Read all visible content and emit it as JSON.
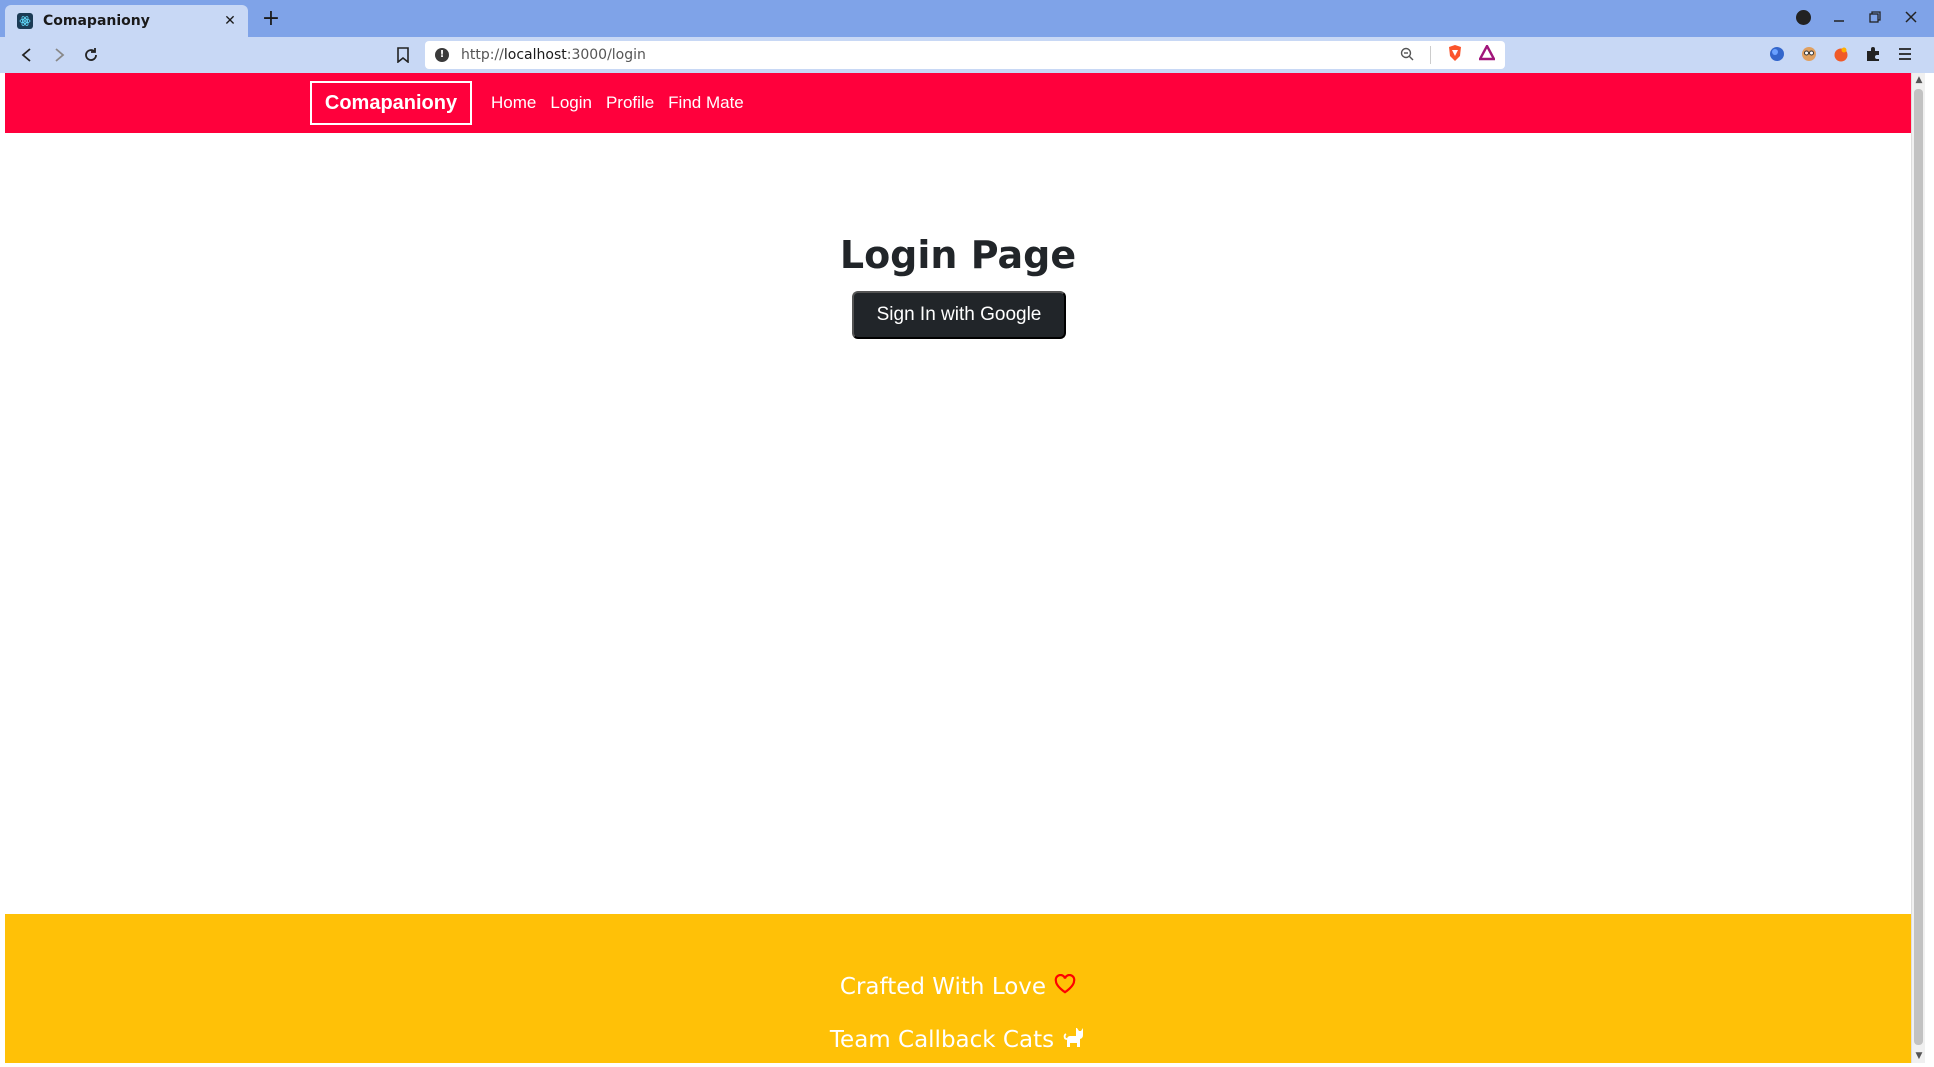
{
  "browser": {
    "tab_title": "Comapaniony",
    "tab_close": "✕",
    "new_tab": "+",
    "url_scheme": "http://",
    "url_host": "localhost",
    "url_path": ":3000/login"
  },
  "navbar": {
    "brand": "Comapaniony",
    "links": [
      "Home",
      "Login",
      "Profile",
      "Find Mate"
    ],
    "color": "#ff003c"
  },
  "main": {
    "title": "Login Page",
    "google_button": "Sign In with Google"
  },
  "footer": {
    "line1": "Crafted With Love",
    "line2": "Team Callback Cats",
    "color": "#ffc107",
    "icons": [
      "heart-icon",
      "cat-icon"
    ]
  }
}
